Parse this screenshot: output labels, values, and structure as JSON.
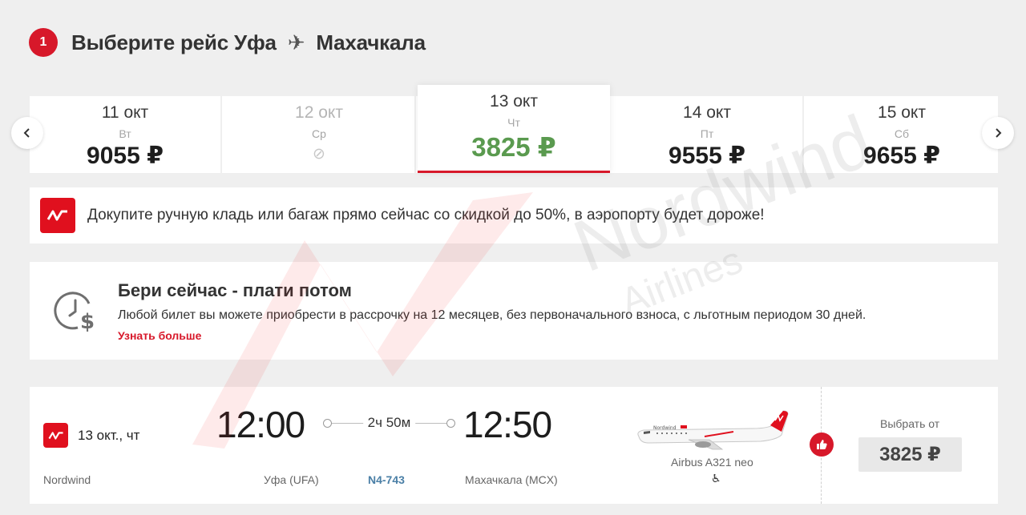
{
  "header": {
    "step_number": "1",
    "title_prefix": "Выберите рейс Уфа",
    "plane_glyph": "✈",
    "title_destination": "Махачкала"
  },
  "date_selector": {
    "prev_icon": "chevron-left-icon",
    "next_icon": "chevron-right-icon",
    "dates": [
      {
        "date": "11 окт",
        "dow": "Вт",
        "price": "9055 ₽",
        "state": "available"
      },
      {
        "date": "12 окт",
        "dow": "Ср",
        "price": "",
        "state": "unavailable"
      },
      {
        "date": "13 окт",
        "dow": "Чт",
        "price": "3825 ₽",
        "state": "selected"
      },
      {
        "date": "14 окт",
        "dow": "Пт",
        "price": "9555 ₽",
        "state": "available"
      },
      {
        "date": "15 окт",
        "dow": "Сб",
        "price": "9655 ₽",
        "state": "available"
      }
    ],
    "unavailable_glyph": "⊘"
  },
  "banner": {
    "text": "Докупите ручную кладь или багаж прямо сейчас со скидкой до 50%, в аэропорту будет дороже!"
  },
  "installment": {
    "title": "Бери сейчас - плати потом",
    "description": "Любой билет вы можете приобрести в рассрочку на 12 месяцев, без первоначального взноса, с льготным периодом 30 дней.",
    "link": "Узнать больше"
  },
  "flight": {
    "date": "13 окт., чт",
    "airline": "Nordwind",
    "departure_time": "12:00",
    "arrival_time": "12:50",
    "duration": "2ч 50м",
    "departure_airport": "Уфа (UFA)",
    "flight_number": "N4-743",
    "arrival_airport": "Махачкала (MCX)",
    "aircraft": "Airbus A321 neo",
    "seat_glyph": "♿",
    "select_label": "Выбрать от",
    "price": "3825 ₽"
  },
  "colors": {
    "brand_red": "#d7182a",
    "selected_price_green": "#5a9a4f",
    "flight_number_blue": "#4a7fa6",
    "background": "#efefef"
  }
}
